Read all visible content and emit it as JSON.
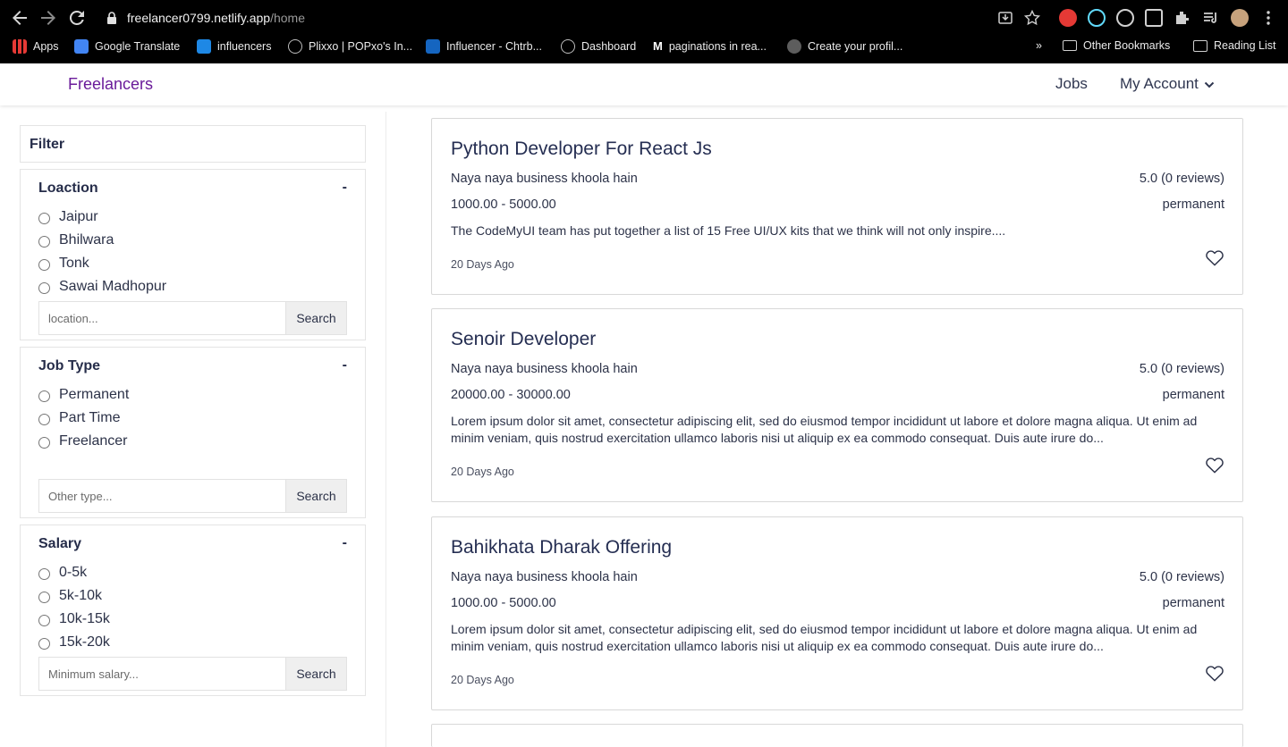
{
  "browser": {
    "url_host": "freelancer0799.netlify.app",
    "url_path": "/home",
    "bookmarks": [
      {
        "label": "Apps",
        "color": "#e53935"
      },
      {
        "label": "Google Translate",
        "color": "#4285f4"
      },
      {
        "label": "influencers",
        "color": "#1e88e5"
      },
      {
        "label": "Plixxo | POPxo's In...",
        "color": "#9e9e9e"
      },
      {
        "label": "Influencer - Chtrb...",
        "color": "#1565c0"
      },
      {
        "label": "Dashboard",
        "color": "#9e9e9e"
      },
      {
        "label": "paginations in rea...",
        "color": "#ffffff"
      },
      {
        "label": "Create your profil...",
        "color": "#bdbdbd"
      }
    ],
    "overflow_label": "»",
    "other_bookmarks": "Other Bookmarks",
    "reading_list": "Reading List"
  },
  "navbar": {
    "brand": "Freelancers",
    "jobs": "Jobs",
    "account": "My Account"
  },
  "filter": {
    "heading": "Filter",
    "location": {
      "title": "Loaction",
      "toggle": "-",
      "options": [
        "Jaipur",
        "Bhilwara",
        "Tonk",
        "Sawai Madhopur"
      ],
      "placeholder": "location...",
      "button": "Search"
    },
    "job_type": {
      "title": "Job Type",
      "toggle": "-",
      "options": [
        "Permanent",
        "Part Time",
        "Freelancer"
      ],
      "placeholder": "Other type...",
      "button": "Search"
    },
    "salary": {
      "title": "Salary",
      "toggle": "-",
      "options": [
        "0-5k",
        "5k-10k",
        "10k-15k",
        "15k-20k"
      ],
      "placeholder": "Minimum salary...",
      "button": "Search"
    }
  },
  "jobs": [
    {
      "title": "Python Developer For React Js",
      "company": "Naya naya business khoola hain",
      "rating": "5.0 (0 reviews)",
      "salary": "1000.00 - 5000.00",
      "type": "permanent",
      "description": "The CodeMyUI team has put together a list of 15 Free UI/UX kits that we think will not only inspire....",
      "posted": "20 Days Ago"
    },
    {
      "title": "Senoir Developer",
      "company": "Naya naya business khoola hain",
      "rating": "5.0 (0 reviews)",
      "salary": "20000.00 - 30000.00",
      "type": "permanent",
      "description": "Lorem ipsum dolor sit amet, consectetur adipiscing elit, sed do eiusmod tempor incididunt ut labore et dolore magna aliqua. Ut enim ad minim veniam, quis nostrud exercitation ullamco laboris nisi ut aliquip ex ea commodo consequat. Duis aute irure do...",
      "posted": "20 Days Ago"
    },
    {
      "title": "Bahikhata Dharak Offering",
      "company": "Naya naya business khoola hain",
      "rating": "5.0 (0 reviews)",
      "salary": "1000.00 - 5000.00",
      "type": "permanent",
      "description": "Lorem ipsum dolor sit amet, consectetur adipiscing elit, sed do eiusmod tempor incididunt ut labore et dolore magna aliqua. Ut enim ad minim veniam, quis nostrud exercitation ullamco laboris nisi ut aliquip ex ea commodo consequat. Duis aute irure do...",
      "posted": "20 Days Ago"
    }
  ]
}
